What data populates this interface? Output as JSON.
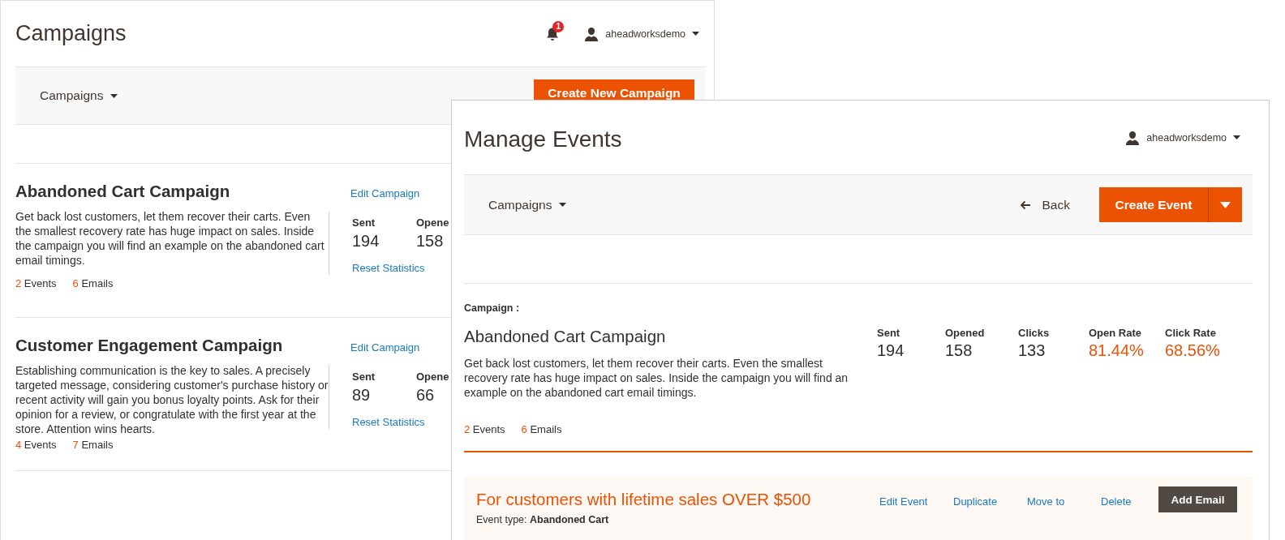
{
  "campaigns_window": {
    "title": "Campaigns",
    "notification_count": "1",
    "user": "aheadworksdemo",
    "toolbar": {
      "menu": "Campaigns",
      "button": "Create New Campaign"
    },
    "campaigns": [
      {
        "title": "Abandoned Cart Campaign",
        "description": "Get back lost customers, let them recover their carts. Even the smallest recovery rate has huge impact on sales. Inside the campaign you will find an example on the abandoned cart email timings.",
        "edit_link": "Edit Campaign",
        "stats": [
          {
            "label": "Sent",
            "value": "194"
          },
          {
            "label": "Opene",
            "value": "158"
          }
        ],
        "reset_link": "Reset Statistics",
        "events_count": "2",
        "events_label": "Events",
        "emails_count": "6",
        "emails_label": "Emails"
      },
      {
        "title": "Customer Engagement Campaign",
        "description": "Establishing communication is the key to sales. A precisely targeted message, considering customer's purchase history or recent activity will gain you bonus loyalty points. Ask for their opinion for a review, or congratulate with the first year at the store. Attention wins hearts.",
        "edit_link": "Edit Campaign",
        "stats": [
          {
            "label": "Sent",
            "value": "89"
          },
          {
            "label": "Opene",
            "value": "66"
          }
        ],
        "reset_link": "Reset Statistics",
        "events_count": "4",
        "events_label": "Events",
        "emails_count": "7",
        "emails_label": "Emails"
      }
    ]
  },
  "events_window": {
    "title": "Manage Events",
    "user": "aheadworksdemo",
    "toolbar": {
      "menu": "Campaigns",
      "back": "Back",
      "button": "Create Event"
    },
    "campaign_label": "Campaign :",
    "campaign": {
      "title": "Abandoned Cart Campaign",
      "description": "Get back lost customers, let them recover their carts. Even the smallest recovery rate has huge impact on sales. Inside the campaign you will find an example on the abandoned cart email timings.",
      "events_count": "2",
      "events_label": "Events",
      "emails_count": "6",
      "emails_label": "Emails",
      "stats": [
        {
          "kind": "count",
          "label": "Sent",
          "value": "194"
        },
        {
          "kind": "count",
          "label": "Opened",
          "value": "158"
        },
        {
          "kind": "count",
          "label": "Clicks",
          "value": "133"
        },
        {
          "kind": "rate",
          "label": "Open Rate",
          "value": "81.44%"
        },
        {
          "kind": "rate",
          "label": "Click Rate",
          "value": "68.56%"
        }
      ]
    },
    "event": {
      "title": "For customers with lifetime sales OVER $500",
      "links": [
        "Edit Event",
        "Duplicate",
        "Move to",
        "Delete"
      ],
      "button": "Add Email",
      "type_label": "Event type:",
      "type_value": "Abandoned Cart"
    }
  }
}
